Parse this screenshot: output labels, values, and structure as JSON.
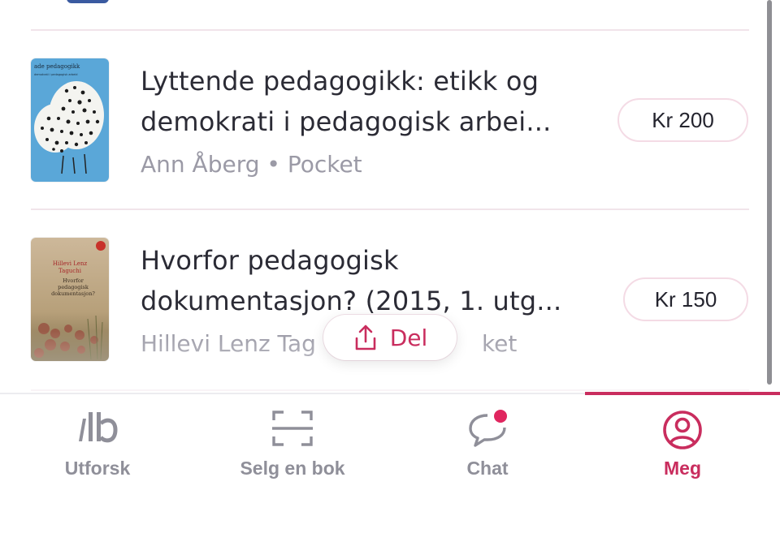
{
  "books": [
    {
      "title_line1": "Lyttende pedagogikk: etikk og",
      "title_line2": "demokrati i pedagogisk arbei...",
      "author": "Ann Åberg",
      "separator": "•",
      "format": "Pocket",
      "price": "Kr 200",
      "cover_text_1": "ade pedagogikk",
      "cover_text_2": "demokrati i pedagogisk arbeid"
    },
    {
      "title_line1": "Hvorfor pedagogisk",
      "title_line2": "dokumentasjon? (2015, 1. utg...",
      "author": "Hillevi Lenz Tag",
      "format_tail": "ket",
      "price": "Kr 150",
      "cover_text_1": "Hillevi Lenz",
      "cover_text_2": "Taguchi",
      "cover_text_3": "Hvorfor",
      "cover_text_4": "pedagogisk",
      "cover_text_5": "dokumentasjon?"
    }
  ],
  "share": {
    "label": "Del",
    "icon": "share-icon"
  },
  "tabs": [
    {
      "label": "Utforsk",
      "icon": "lb-logo-icon",
      "active": false
    },
    {
      "label": "Selg en bok",
      "icon": "scan-icon",
      "active": false
    },
    {
      "label": "Chat",
      "icon": "chat-icon",
      "active": false,
      "badge": true
    },
    {
      "label": "Meg",
      "icon": "profile-icon",
      "active": true
    }
  ],
  "colors": {
    "accent": "#c92d5e",
    "inactive": "#8f8f99",
    "text": "#2b2b35",
    "meta": "#9b9aa6"
  }
}
